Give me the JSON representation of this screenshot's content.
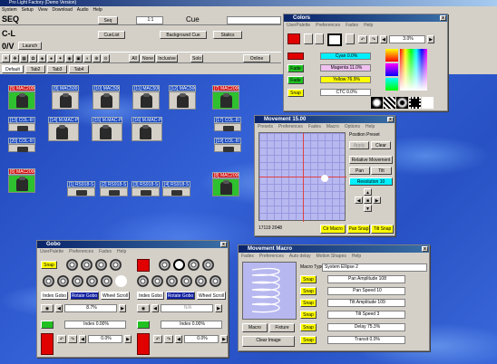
{
  "app": {
    "title": "Pro Light Factory (Demo Version)"
  },
  "menubar": [
    "System",
    "Setup",
    "View",
    "Download",
    "Audio",
    "Help"
  ],
  "rows": {
    "seq": {
      "label": "SEQ",
      "num": "1:1",
      "cue": "Cue"
    },
    "cl": {
      "label": "C-L"
    },
    "ov": {
      "label": "0/V",
      "launch": "Launch"
    }
  },
  "buttons": {
    "seq": "Seq",
    "cuelist": "CueList",
    "background_cue": "Background Cue",
    "statics": "Statics",
    "all": "All",
    "none": "None",
    "inclusive": "Inclusive",
    "solo": "Solo",
    "online": "Online"
  },
  "tabs": [
    "Default",
    "Tab2",
    "Tab3",
    "Tab4"
  ],
  "fixtures": [
    {
      "label": "[5] MAC2000"
    },
    {
      "label": "[9] MAC500"
    },
    {
      "label": "[10] MAC500"
    },
    {
      "label": "[11] MAC500"
    },
    {
      "label": "[12] MAC500"
    },
    {
      "label": "[7] MAC2000"
    },
    {
      "label": "[13] COL-III"
    },
    {
      "label": "[14] M.MAC-P"
    },
    {
      "label": "[15] M.MAC-P"
    },
    {
      "label": "[16] M.MAC-P"
    },
    {
      "label": "[17] COL-III"
    },
    {
      "label": "[20] COL-III"
    },
    {
      "label": "[19] COL-III"
    },
    {
      "label": "[6] MAC2000"
    },
    {
      "label": "[8] MAC2000"
    },
    {
      "label": "[1] RS918-S"
    },
    {
      "label": "[2] RS918-S"
    },
    {
      "label": "[3] RS918-S"
    },
    {
      "label": "[4] RS918-S"
    }
  ],
  "colors_win": {
    "title": "Colors",
    "menu": [
      "UserPalette",
      "Preferences",
      "Fades",
      "Help"
    ],
    "pct": "3.0%",
    "cyan": "Cyan 0.0%",
    "magenta": "Magenta 11.0%",
    "yellow": "Yellow 76.9%",
    "ctc": "CTC 0.0%",
    "fade": "Fade",
    "snap": "Snap"
  },
  "movement_win": {
    "title": "Movement 15.00",
    "menu": [
      "Presets",
      "Preferences",
      "Fades",
      "Macro",
      "Options",
      "Help"
    ],
    "position_preset": "Position Preset",
    "apply": "Apply",
    "clear": "Clear",
    "relative": "Relative Movement",
    "pan": "Pan",
    "tilt": "Tilt",
    "resolution": "Resolution 10",
    "coords": "17119  2048",
    "cir_macro": "Cir Macro",
    "pan_snap": "Pan Snap",
    "tilt_snap": "Tilt Snap"
  },
  "gobo_win": {
    "title": "Gobo",
    "menu": [
      "UserPalette",
      "Preferences",
      "Fades",
      "Help"
    ],
    "snap": "Snap",
    "index_gobo": "Index Gobo",
    "rotate_gobo": "Rotate Gobo",
    "wheel_scroll": "Wheel Scroll",
    "pct1": "8.7%",
    "pct2": "N/A",
    "index1": "Index 0.00%",
    "index2": "Index 0.00%",
    "pct3": "0.0%",
    "pct4": "0.0%"
  },
  "macro_win": {
    "title": "Movement Macro",
    "menu": [
      "Fades",
      "Preferences",
      "Auto delay",
      "Motion Shapes",
      "Help"
    ],
    "macro_type_label": "Macro Type",
    "macro_type": "System Ellipse 2",
    "snap": "Snap",
    "pan_amp": "Pan Amplitude 108",
    "pan_speed": "Pan Speed 10",
    "tilt_amp": "Tilt Amplitude 109",
    "tilt_speed": "Tilt Speed 3",
    "delay": "Delay 75.3%",
    "transit": "Transit 0.0%",
    "macro": "Macro",
    "fixture": "Fixture",
    "clear_image": "Clear Image"
  },
  "colors": {
    "accent": "#0a246a",
    "red": "#e00000",
    "green": "#20c020",
    "yellow": "#ffff00"
  }
}
